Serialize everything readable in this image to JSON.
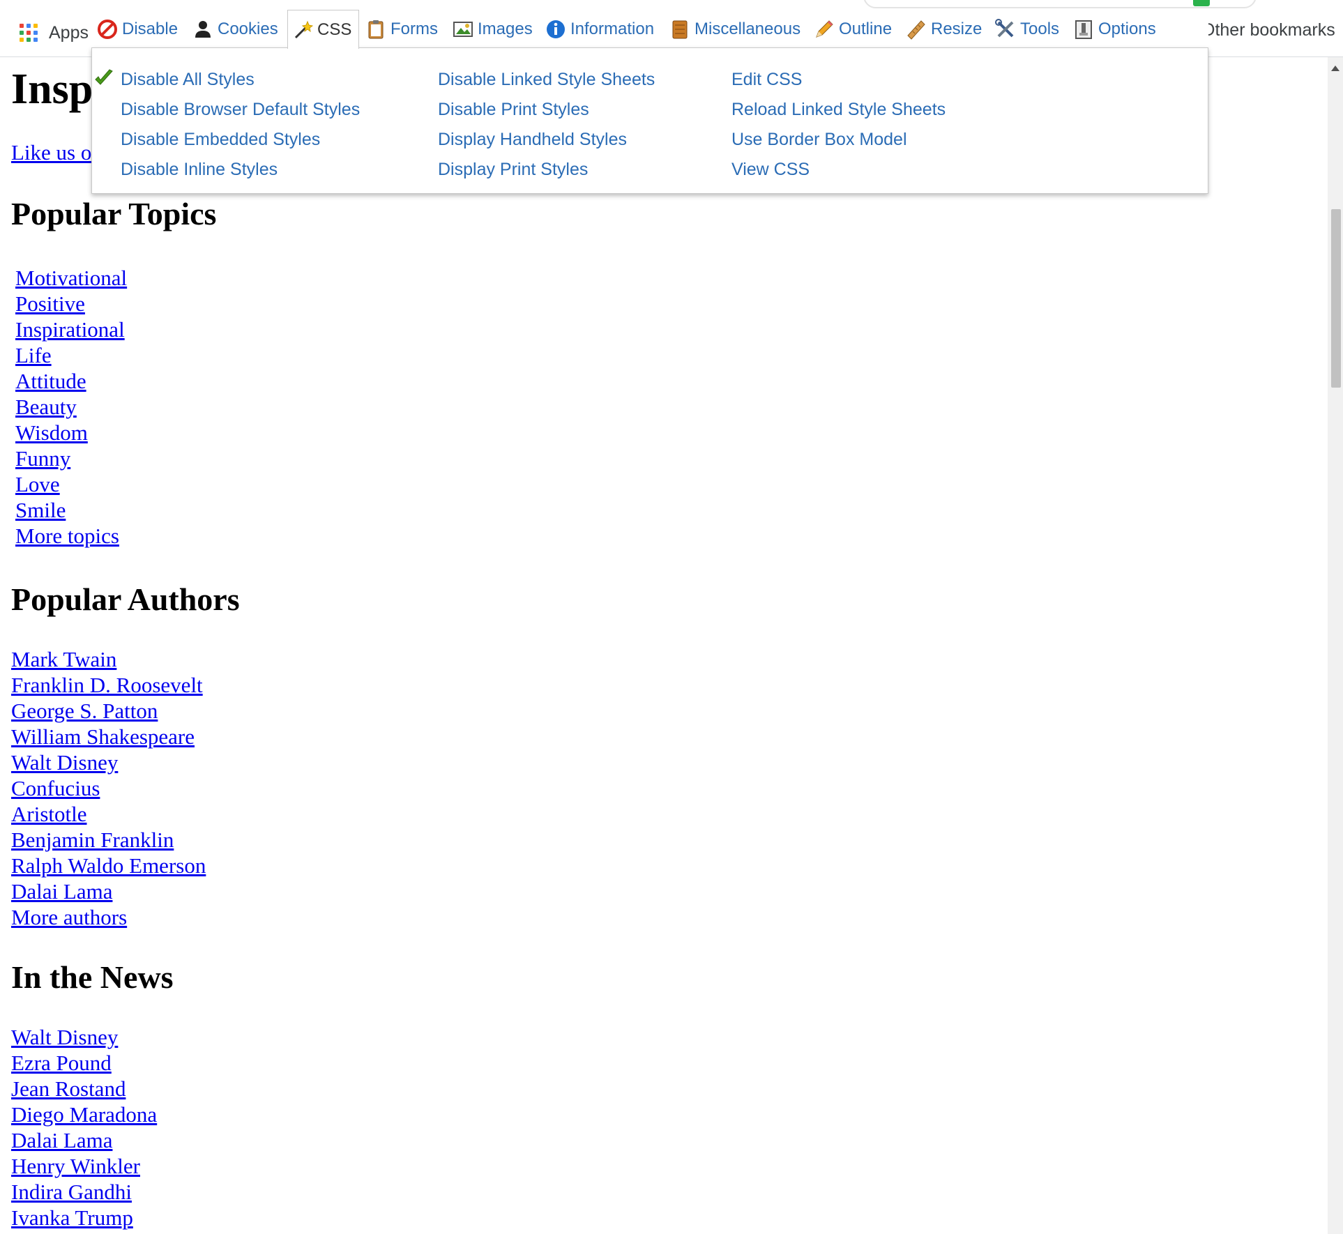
{
  "browser": {
    "apps_label": "Apps",
    "other_bookmarks": "Other bookmarks"
  },
  "toolbar": {
    "active_tab": "CSS",
    "tabs": [
      {
        "label": "Disable",
        "icon": "disable-icon"
      },
      {
        "label": "Cookies",
        "icon": "cookies-icon"
      },
      {
        "label": "CSS",
        "icon": "css-wand-icon"
      },
      {
        "label": "Forms",
        "icon": "forms-clipboard-icon"
      },
      {
        "label": "Images",
        "icon": "images-icon"
      },
      {
        "label": "Information",
        "icon": "information-icon"
      },
      {
        "label": "Miscellaneous",
        "icon": "miscellaneous-icon"
      },
      {
        "label": "Outline",
        "icon": "outline-pencil-icon"
      },
      {
        "label": "Resize",
        "icon": "resize-ruler-icon"
      },
      {
        "label": "Tools",
        "icon": "tools-icon"
      },
      {
        "label": "Options",
        "icon": "options-icon"
      }
    ]
  },
  "css_menu": {
    "columns": [
      [
        {
          "label": "Disable All Styles",
          "checked": true
        },
        {
          "label": "Disable Browser Default Styles"
        },
        {
          "label": "Disable Embedded Styles"
        },
        {
          "label": "Disable Inline Styles"
        }
      ],
      [
        {
          "label": "Disable Linked Style Sheets"
        },
        {
          "label": "Disable Print Styles"
        },
        {
          "label": "Display Handheld Styles"
        },
        {
          "label": "Display Print Styles"
        }
      ],
      [
        {
          "label": "Edit CSS"
        },
        {
          "label": "Reload Linked Style Sheets"
        },
        {
          "label": "Use Border Box Model"
        },
        {
          "label": "View CSS"
        }
      ]
    ]
  },
  "page": {
    "title": "Insp",
    "like_link": "Like us o",
    "sections": [
      {
        "heading": "Popular Topics",
        "links": [
          "Motivational",
          "Positive",
          "Inspirational",
          "Life",
          "Attitude",
          "Beauty",
          "Wisdom",
          "Funny",
          "Love",
          "Smile",
          "More topics"
        ]
      },
      {
        "heading": "Popular Authors",
        "links": [
          "Mark Twain",
          "Franklin D. Roosevelt",
          "George S. Patton",
          "William Shakespeare",
          "Walt Disney",
          "Confucius",
          "Aristotle",
          "Benjamin Franklin",
          "Ralph Waldo Emerson",
          "Dalai Lama",
          "More authors"
        ]
      },
      {
        "heading": "In the News",
        "links": [
          "Walt Disney",
          "Ezra Pound",
          "Jean Rostand",
          "Diego Maradona",
          "Dalai Lama",
          "Henry Winkler",
          "Indira Gandhi",
          "Ivanka Trump"
        ]
      }
    ]
  },
  "colors": {
    "menu_link": "#2b6cb5",
    "page_link": "#0000ee",
    "check": "#4a9a1a",
    "extension_badge": "#2bb24c"
  }
}
